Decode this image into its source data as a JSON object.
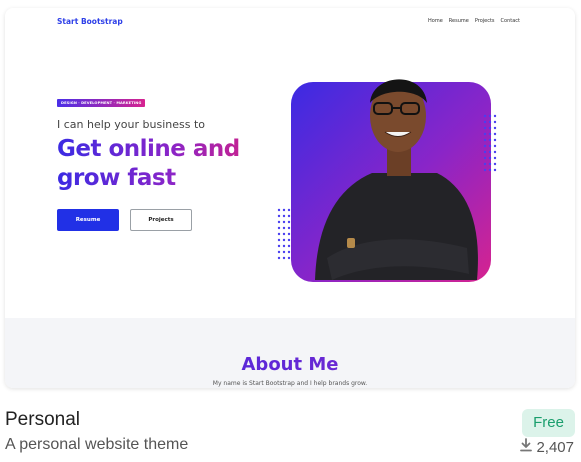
{
  "preview": {
    "brand": "Start Bootstrap",
    "nav": [
      "Home",
      "Resume",
      "Projects",
      "Contact"
    ],
    "tagline": "DESIGN · DEVELOPMENT · MARKETING",
    "lead": "I can help your business to",
    "headline": "Get online and grow fast",
    "primary_button": "Resume",
    "secondary_button": "Projects",
    "about_title": "About Me",
    "about_text": "My name is Start Bootstrap and I help brands grow."
  },
  "card": {
    "title": "Personal",
    "description": "A personal website theme",
    "price_badge": "Free",
    "downloads": "2,407"
  },
  "colors": {
    "accent_blue": "#2130e6",
    "gradient_start": "#3b2be3",
    "gradient_end": "#c7228f",
    "badge_bg": "#dcf3ea",
    "badge_text": "#1a9e6d"
  },
  "icons": {
    "download": "download-icon"
  }
}
